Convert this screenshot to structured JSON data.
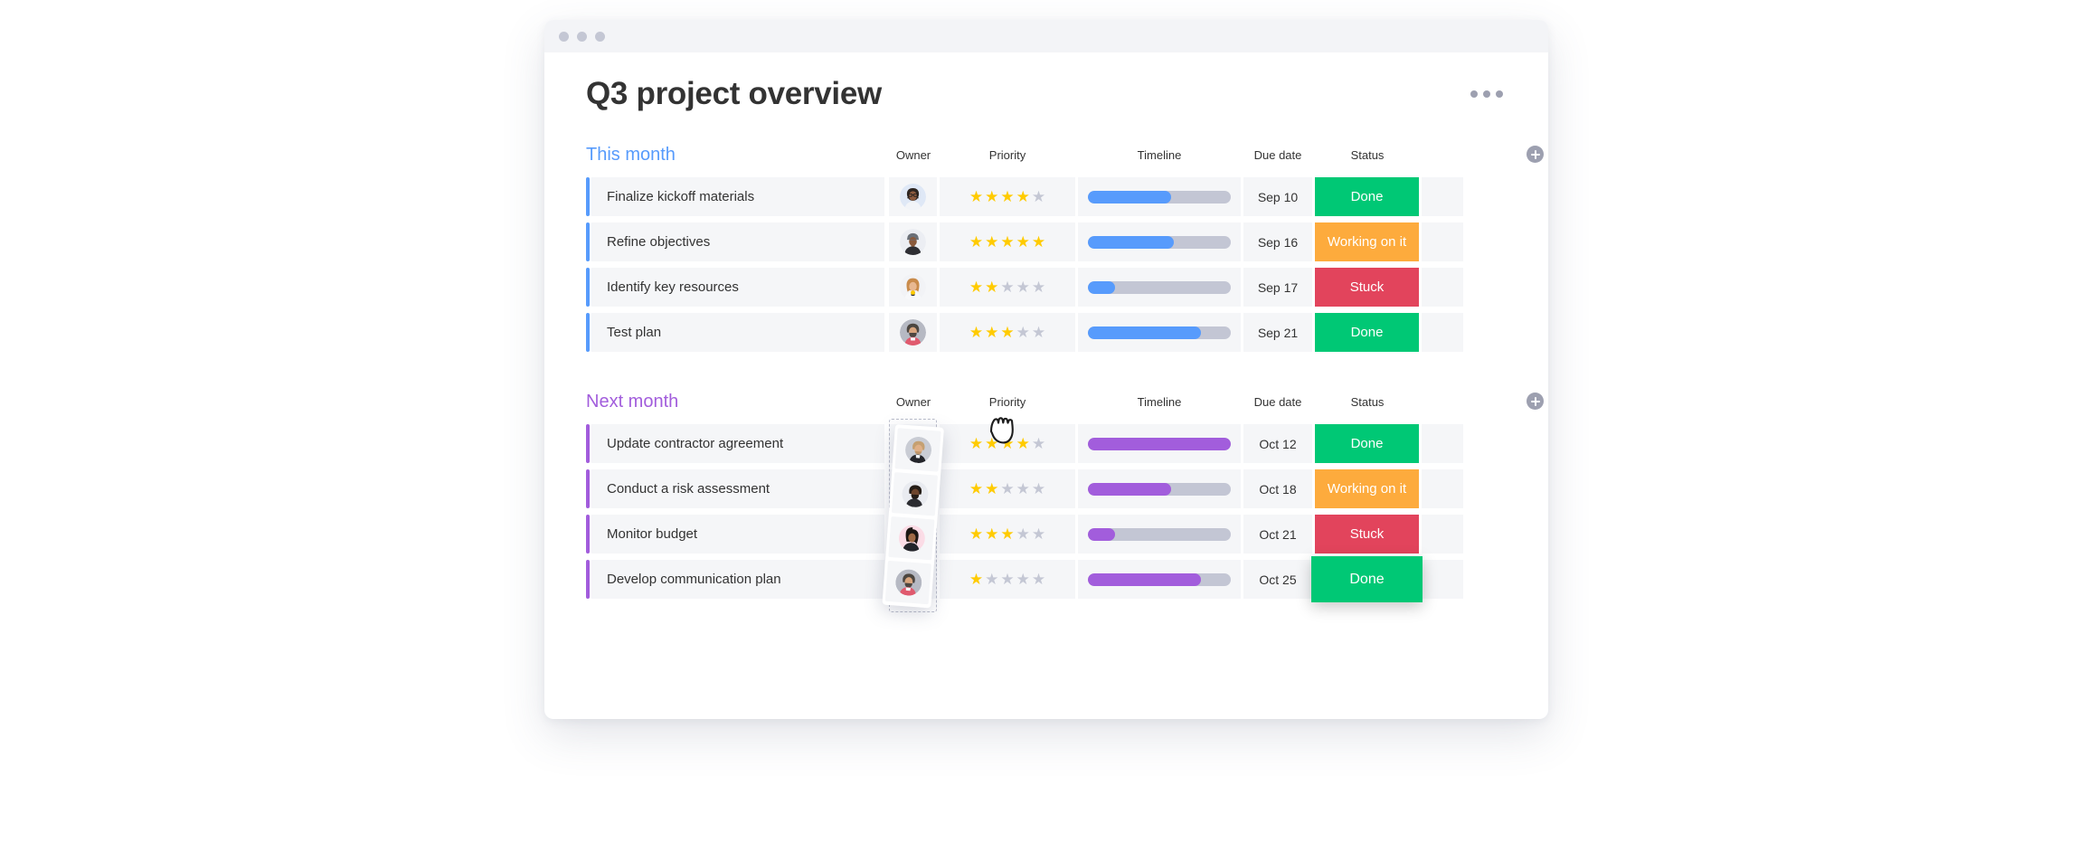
{
  "window": {
    "traffic_lights": [
      "dot",
      "dot",
      "dot"
    ],
    "page_title": "Q3 project overview",
    "more_menu": "more-options"
  },
  "columns": {
    "name": "",
    "owner": "Owner",
    "priority": "Priority",
    "timeline": "Timeline",
    "due_date": "Due date",
    "status": "Status",
    "add_column": "+"
  },
  "groups": [
    {
      "title": "This month",
      "color": "#579bfc",
      "accent": "blue",
      "rows": [
        {
          "name": "Finalize kickoff materials",
          "owner": "avatar-woman-glasses",
          "priority": 4,
          "priority_max": 5,
          "timeline_percent": 58,
          "due_date": "Sep 10",
          "status": "Done",
          "status_color": "#00c875"
        },
        {
          "name": "Refine objectives",
          "owner": "avatar-man-cap",
          "priority": 5,
          "priority_max": 5,
          "timeline_percent": 60,
          "due_date": "Sep 16",
          "status": "Working on it",
          "status_color": "#fdab3d"
        },
        {
          "name": "Identify key resources",
          "owner": "avatar-woman-blonde",
          "priority": 2,
          "priority_max": 5,
          "timeline_percent": 19,
          "due_date": "Sep 17",
          "status": "Stuck",
          "status_color": "#e2445c"
        },
        {
          "name": "Test plan",
          "owner": "avatar-man-beard-gray",
          "priority": 3,
          "priority_max": 5,
          "timeline_percent": 79,
          "due_date": "Sep 21",
          "status": "Done",
          "status_color": "#00c875"
        }
      ]
    },
    {
      "title": "Next month",
      "color": "#a25ddc",
      "accent": "purple",
      "rows": [
        {
          "name": "Update contractor agreement",
          "owner": "avatar-man-blond",
          "priority": 4,
          "priority_max": 5,
          "timeline_percent": 100,
          "due_date": "Oct 12",
          "status": "Done",
          "status_color": "#00c875"
        },
        {
          "name": "Conduct a risk assessment",
          "owner": "avatar-man-beard-dark",
          "priority": 2,
          "priority_max": 5,
          "timeline_percent": 58,
          "due_date": "Oct 18",
          "status": "Working on it",
          "status_color": "#fdab3d"
        },
        {
          "name": "Monitor budget",
          "owner": "avatar-woman-dark-hair",
          "priority": 3,
          "priority_max": 5,
          "timeline_percent": 19,
          "due_date": "Oct 21",
          "status": "Stuck",
          "status_color": "#e2445c"
        },
        {
          "name": "Develop communication plan",
          "owner": "avatar-man-beard-pink",
          "priority": 1,
          "priority_max": 5,
          "timeline_percent": 79,
          "due_date": "Oct 25",
          "status": "Done",
          "status_color": "#00c875"
        }
      ]
    }
  ],
  "drag_state": {
    "dragged_column": "Owner",
    "cursor": "grabbing-hand",
    "highlighted_cell": "Done"
  }
}
